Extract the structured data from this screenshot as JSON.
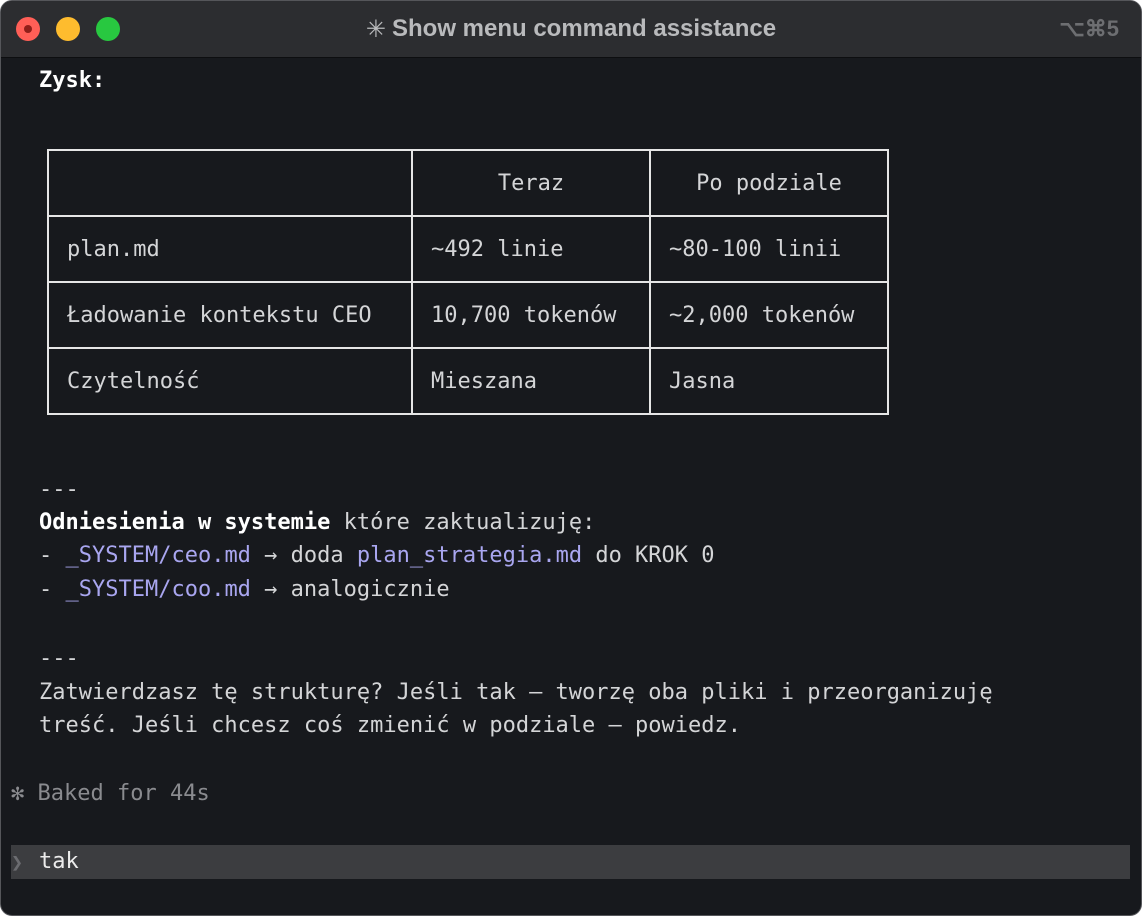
{
  "window": {
    "title": "Show menu command assistance",
    "title_icon": "✳",
    "shortcut": "⌥⌘5"
  },
  "content": {
    "heading": "Zysk:",
    "table": {
      "header": [
        "",
        "Teraz",
        "Po podziale"
      ],
      "rows": [
        [
          "plan.md",
          "~492 linie",
          "~80-100 linii"
        ],
        [
          "Ładowanie kontekstu CEO",
          "10,700 tokenów",
          "~2,000 tokenów"
        ],
        [
          "Czytelność",
          "Mieszana",
          "Jasna"
        ]
      ]
    },
    "separator1": "---",
    "refs_bold": "Odniesienia w systemie",
    "refs_rest": " które zaktualizuję:",
    "ref1": {
      "dash": "- ",
      "file": "_SYSTEM/ceo.md",
      "arrow": " → doda ",
      "target": "plan_strategia.md",
      "tail": " do KROK 0"
    },
    "ref2": {
      "dash": "- ",
      "file": "_SYSTEM/coo.md",
      "arrow": " → analogicznie"
    },
    "separator2": "---",
    "question_line1": "Zatwierdzasz tę strukturę? Jeśli tak — tworzę oba pliki i przeorganizuję",
    "question_line2": "treść. Jeśli chcesz coś zmienić w podziale — powiedz."
  },
  "status": {
    "icon": "✻",
    "text": "Baked for 44s"
  },
  "prompt": {
    "caret": "❯",
    "value": "tak"
  },
  "colors": {
    "background": "#17191d",
    "titlebar": "#2c2d30",
    "link": "#a9a6f0",
    "close": "#ff5f57",
    "minimize": "#febc2e",
    "maximize": "#28c840"
  }
}
